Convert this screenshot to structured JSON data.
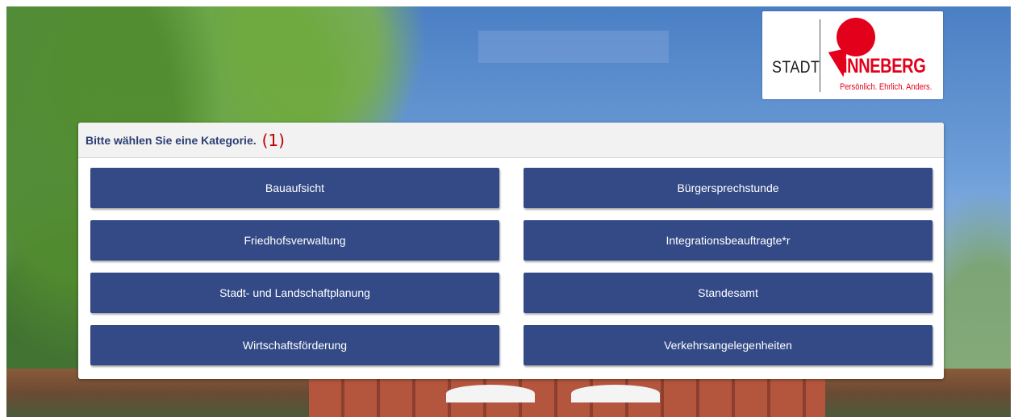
{
  "logo": {
    "stadt": "STADT",
    "name": "PINNEBERG",
    "name_rest": "INNEBERG",
    "tagline": "Persönlich. Ehrlich. Anders."
  },
  "panel": {
    "title": "Bitte wählen Sie eine Kategorie.",
    "annotation": "(1)"
  },
  "categories": [
    {
      "label": "Bauaufsicht"
    },
    {
      "label": "Bürgersprechstunde"
    },
    {
      "label": "Friedhofsverwaltung"
    },
    {
      "label": "Integrationsbeauftragte*r"
    },
    {
      "label": "Stadt- und Landschaftplanung"
    },
    {
      "label": "Standesamt"
    },
    {
      "label": "Wirtschaftsförderung"
    },
    {
      "label": "Verkehrsangelegenheiten"
    }
  ],
  "colors": {
    "button": "#334a87",
    "title": "#2c3e74",
    "brand_red": "#e2001a",
    "annotation": "#c00000"
  }
}
